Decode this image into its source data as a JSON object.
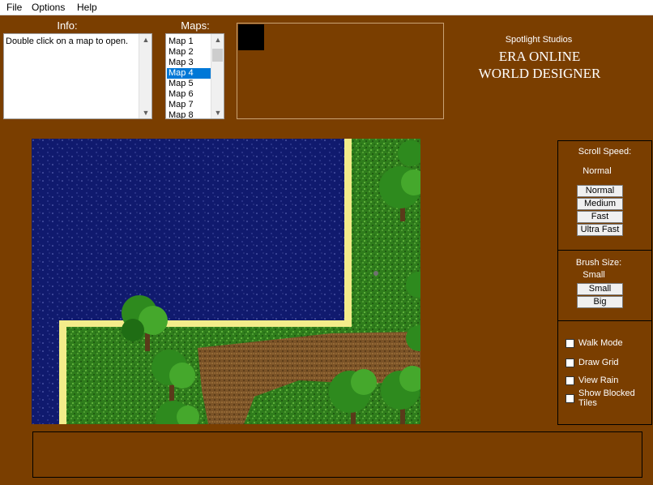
{
  "menu": {
    "items": [
      "File",
      "Options",
      "Help"
    ]
  },
  "info": {
    "heading": "Info:",
    "text": "Double click on a map to open."
  },
  "maps": {
    "heading": "Maps:",
    "items": [
      "Map 1",
      "Map 2",
      "Map 3",
      "Map 4",
      "Map 5",
      "Map 6",
      "Map 7",
      "Map 8"
    ],
    "selected": "Map 4"
  },
  "branding": {
    "studio": "Spotlight Studios",
    "line1": "ERA ONLINE",
    "line2": "WORLD DESIGNER"
  },
  "scroll_speed": {
    "heading": "Scroll Speed:",
    "current": "Normal",
    "buttons": [
      "Normal",
      "Medium",
      "Fast",
      "Ultra Fast"
    ]
  },
  "brush": {
    "heading": "Brush Size:",
    "current": "Small",
    "buttons": [
      "Small",
      "Big"
    ]
  },
  "options": {
    "checkboxes": [
      {
        "label": "Walk Mode",
        "checked": false
      },
      {
        "label": "Draw Grid",
        "checked": false
      },
      {
        "label": "View Rain",
        "checked": false
      },
      {
        "label": "Show Blocked Tiles",
        "checked": false
      }
    ]
  },
  "colors": {
    "background": "#7a3e00",
    "water": "#101a6e",
    "grass": "#2f7d1c",
    "sand": "#f3ec8a",
    "dirt": "#7b5327",
    "selection": "#0078d7"
  }
}
